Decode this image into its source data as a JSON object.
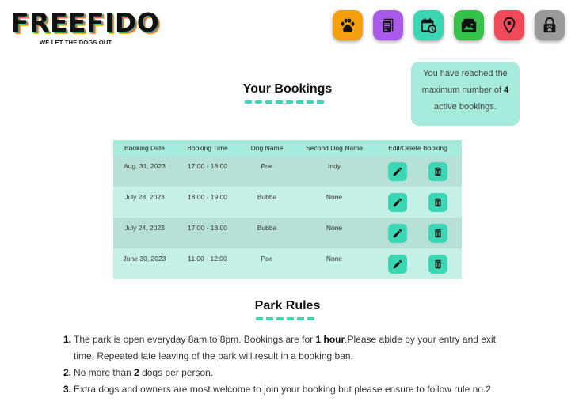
{
  "brand": {
    "name": "FREEFIDO",
    "tagline": "WE LET THE DOGS OUT"
  },
  "nav": [
    {
      "name": "dogs",
      "icon": "paw-icon",
      "color": "#f5a00f"
    },
    {
      "name": "rules",
      "icon": "document-icon",
      "color": "#a95ae8"
    },
    {
      "name": "bookings",
      "icon": "calendar-clock-icon",
      "color": "#3cd6b4"
    },
    {
      "name": "gallery",
      "icon": "photo-wallet-icon",
      "color": "#36c24a"
    },
    {
      "name": "location",
      "icon": "map-pin-icon",
      "color": "#f04a5a"
    },
    {
      "name": "logout",
      "icon": "lock-paw-icon",
      "color": "#9a9a9a"
    }
  ],
  "alert": {
    "prefix": "You have reached the maximum number of",
    "count": "4",
    "suffix": "active bookings."
  },
  "bookings": {
    "title": "Your Bookings",
    "columns": [
      "Booking Date",
      "Booking Time",
      "Dog Name",
      "Second Dog Name",
      "Edit/Delete Booking"
    ],
    "rows": [
      {
        "date": "Aug. 31, 2023",
        "time": "17:00 - 18:00",
        "dog": "Poe",
        "second_dog": "Indy"
      },
      {
        "date": "July 28, 2023",
        "time": "18:00 - 19:00",
        "dog": "Bubba",
        "second_dog": "None"
      },
      {
        "date": "July 24, 2023",
        "time": "17:00 - 18:00",
        "dog": "Bubba",
        "second_dog": "None"
      },
      {
        "date": "June 30, 2023",
        "time": "11:00 - 12:00",
        "dog": "Poe",
        "second_dog": "None"
      }
    ]
  },
  "park_rules": {
    "title": "Park Rules",
    "items": [
      {
        "num": "1.",
        "a": "The park is open everyday 8am to 8pm. Bookings are for ",
        "b": "1 hour",
        "c": ".Please abide by your entry and exit time. Repeated late leaving of the park will result in a booking ban."
      },
      {
        "num": "2.",
        "a": "No more than ",
        "b": "2",
        "c": " dogs per person."
      },
      {
        "num": "3.",
        "a": "Extra dogs and owners are most welcome to join your booking but please ensure to follow rule no.2",
        "b": "",
        "c": ""
      }
    ]
  }
}
